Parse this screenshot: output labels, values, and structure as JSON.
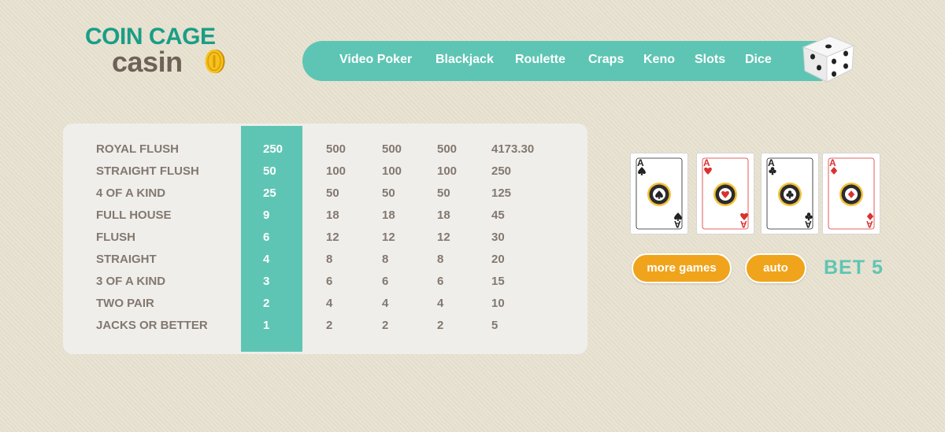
{
  "logo": {
    "line1": "COIN CAGE",
    "line2": "casin"
  },
  "nav": {
    "items": [
      "Video Poker",
      "Blackjack",
      "Roulette",
      "Craps",
      "Keno",
      "Slots",
      "Dice"
    ]
  },
  "paytable": {
    "rows": [
      {
        "hand": "ROYAL FLUSH",
        "pays": [
          "250",
          "500",
          "500",
          "500",
          "4173.30"
        ]
      },
      {
        "hand": "STRAIGHT FLUSH",
        "pays": [
          "50",
          "100",
          "100",
          "100",
          "250"
        ]
      },
      {
        "hand": "4 OF A KIND",
        "pays": [
          "25",
          "50",
          "50",
          "50",
          "125"
        ]
      },
      {
        "hand": "FULL HOUSE",
        "pays": [
          "9",
          "18",
          "18",
          "18",
          "45"
        ]
      },
      {
        "hand": "FLUSH",
        "pays": [
          "6",
          "12",
          "12",
          "12",
          "30"
        ]
      },
      {
        "hand": "STRAIGHT",
        "pays": [
          "4",
          "8",
          "8",
          "8",
          "20"
        ]
      },
      {
        "hand": "3 OF A KIND",
        "pays": [
          "3",
          "6",
          "6",
          "6",
          "15"
        ]
      },
      {
        "hand": "TWO PAIR",
        "pays": [
          "2",
          "4",
          "4",
          "4",
          "10"
        ]
      },
      {
        "hand": "JACKS OR BETTER",
        "pays": [
          "1",
          "2",
          "2",
          "2",
          "5"
        ]
      }
    ]
  },
  "cards": [
    {
      "rank": "A",
      "suit": "spade",
      "color": "#222222"
    },
    {
      "rank": "A",
      "suit": "heart",
      "color": "#d9322f"
    },
    {
      "rank": "A",
      "suit": "club",
      "color": "#222222"
    },
    {
      "rank": "A",
      "suit": "diamond",
      "color": "#d9322f"
    }
  ],
  "buttons": {
    "more_games": "more games",
    "auto": "auto"
  },
  "bet": {
    "label": "BET 5"
  },
  "colors": {
    "teal": "#5ec5b4",
    "logo_green": "#1a9e86",
    "orange": "#f0a41c",
    "text": "#837870",
    "background": "#e8e1d0"
  },
  "icons": {
    "coin": "gold-coin-icon",
    "dice": "dice-icon"
  }
}
